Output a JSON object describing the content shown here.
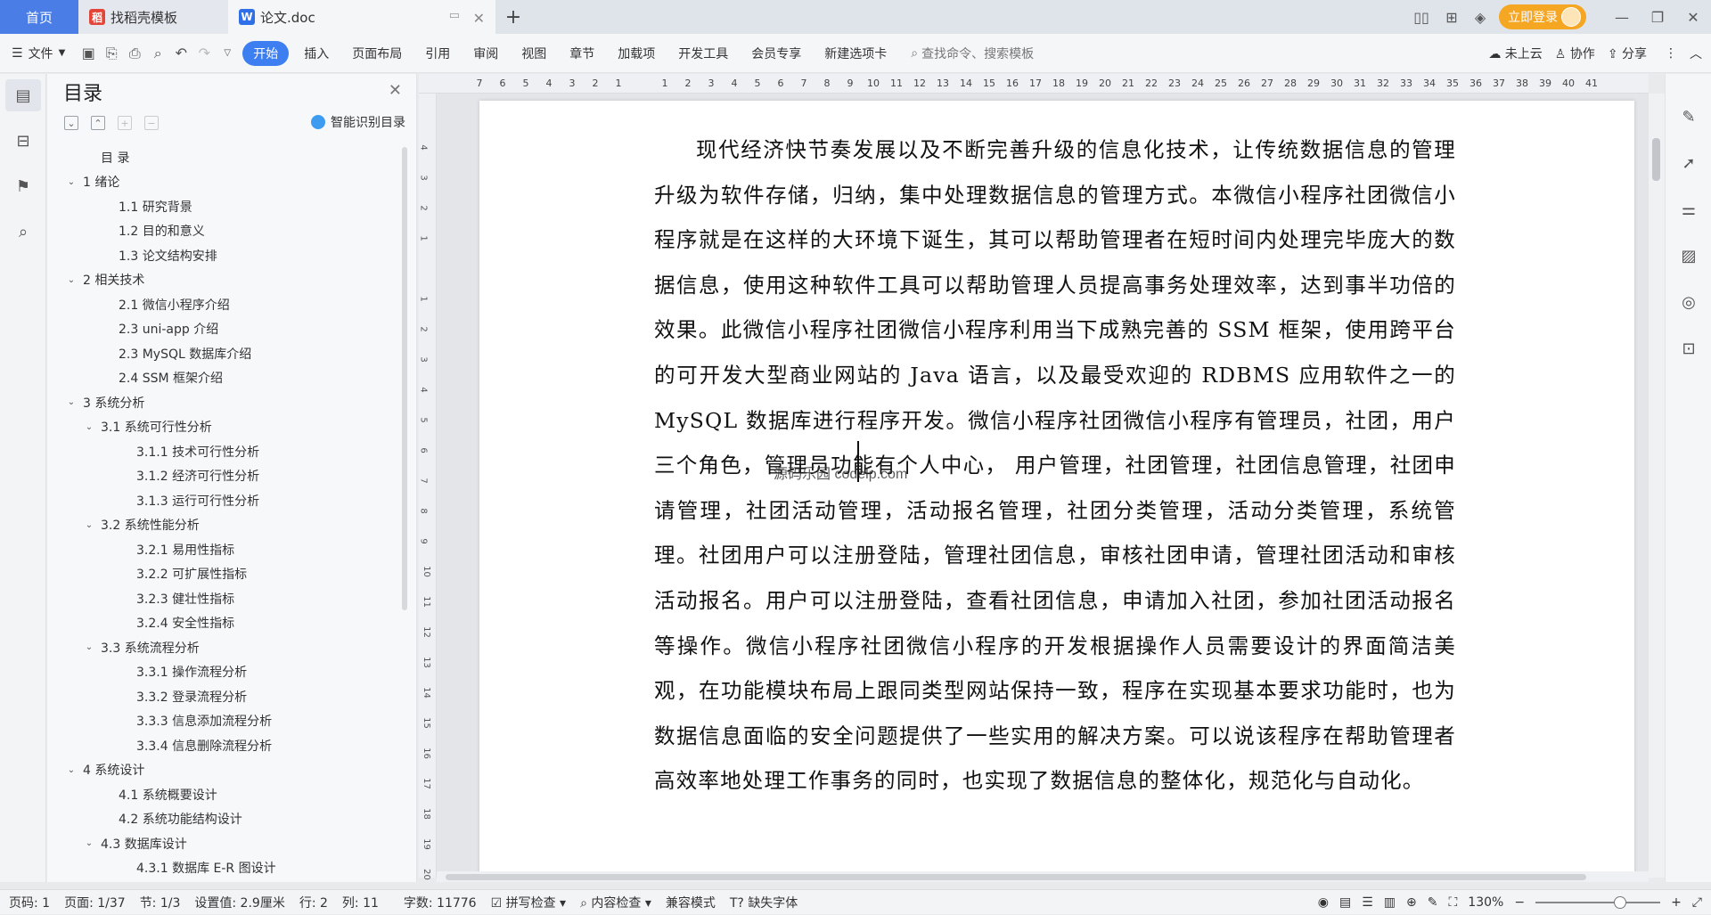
{
  "titlebar": {
    "home_tab": "首页",
    "tab1": "找稻壳模板",
    "tab2": "论文.doc",
    "login": "立即登录"
  },
  "toolbar": {
    "file": "文件",
    "tabs": [
      "开始",
      "插入",
      "页面布局",
      "引用",
      "审阅",
      "视图",
      "章节",
      "加载项",
      "开发工具",
      "会员专享",
      "新建选项卡"
    ],
    "search_placeholder": "查找命令、搜索模板",
    "cloud": "未上云",
    "collab": "协作",
    "share": "分享"
  },
  "toc": {
    "title": "目录",
    "smart": "智能识别目录",
    "items": [
      {
        "label": "目  录",
        "level": 1,
        "arrow": ""
      },
      {
        "label": "1 绪论",
        "level": 0,
        "arrow": "v"
      },
      {
        "label": "1.1  研究背景",
        "level": 2,
        "arrow": ""
      },
      {
        "label": "1.2  目的和意义",
        "level": 2,
        "arrow": ""
      },
      {
        "label": "1.3  论文结构安排",
        "level": 2,
        "arrow": ""
      },
      {
        "label": "2 相关技术",
        "level": 0,
        "arrow": "v"
      },
      {
        "label": "2.1  微信小程序介绍",
        "level": 2,
        "arrow": ""
      },
      {
        "label": "2.3 uni-app 介绍",
        "level": 2,
        "arrow": ""
      },
      {
        "label": "2.3 MySQL 数据库介绍",
        "level": 2,
        "arrow": ""
      },
      {
        "label": "2.4 SSM 框架介绍",
        "level": 2,
        "arrow": ""
      },
      {
        "label": "3 系统分析",
        "level": 0,
        "arrow": "v"
      },
      {
        "label": "3.1  系统可行性分析",
        "level": 1,
        "arrow": "v"
      },
      {
        "label": "3.1.1  技术可行性分析",
        "level": 3,
        "arrow": ""
      },
      {
        "label": "3.1.2  经济可行性分析",
        "level": 3,
        "arrow": ""
      },
      {
        "label": "3.1.3  运行可行性分析",
        "level": 3,
        "arrow": ""
      },
      {
        "label": "3.2  系统性能分析",
        "level": 1,
        "arrow": "v"
      },
      {
        "label": "3.2.1  易用性指标",
        "level": 3,
        "arrow": ""
      },
      {
        "label": "3.2.2  可扩展性指标",
        "level": 3,
        "arrow": ""
      },
      {
        "label": "3.2.3  健壮性指标",
        "level": 3,
        "arrow": ""
      },
      {
        "label": "3.2.4  安全性指标",
        "level": 3,
        "arrow": ""
      },
      {
        "label": "3.3  系统流程分析",
        "level": 1,
        "arrow": "v"
      },
      {
        "label": "3.3.1  操作流程分析",
        "level": 3,
        "arrow": ""
      },
      {
        "label": "3.3.2  登录流程分析",
        "level": 3,
        "arrow": ""
      },
      {
        "label": "3.3.3  信息添加流程分析",
        "level": 3,
        "arrow": ""
      },
      {
        "label": "3.3.4  信息删除流程分析",
        "level": 3,
        "arrow": ""
      },
      {
        "label": "4 系统设计",
        "level": 0,
        "arrow": "v"
      },
      {
        "label": "4.1  系统概要设计",
        "level": 2,
        "arrow": ""
      },
      {
        "label": "4.2  系统功能结构设计",
        "level": 2,
        "arrow": ""
      },
      {
        "label": "4.3  数据库设计",
        "level": 1,
        "arrow": "v"
      },
      {
        "label": "4.3.1  数据库 E-R 图设计",
        "level": 3,
        "arrow": ""
      }
    ]
  },
  "ruler": {
    "h": [
      "7",
      "6",
      "5",
      "4",
      "3",
      "2",
      "1",
      "",
      "1",
      "2",
      "3",
      "4",
      "5",
      "6",
      "7",
      "8",
      "9",
      "10",
      "11",
      "12",
      "13",
      "14",
      "15",
      "16",
      "17",
      "18",
      "19",
      "20",
      "21",
      "22",
      "23",
      "24",
      "25",
      "26",
      "27",
      "28",
      "29",
      "30",
      "31",
      "32",
      "33",
      "34",
      "35",
      "36",
      "37",
      "38",
      "39",
      "40",
      "41"
    ],
    "v": [
      "4",
      "3",
      "2",
      "1",
      "",
      "1",
      "2",
      "3",
      "4",
      "5",
      "6",
      "7",
      "8",
      "9",
      "10",
      "11",
      "12",
      "13",
      "14",
      "15",
      "16",
      "17",
      "18",
      "19",
      "20"
    ]
  },
  "document": {
    "paragraph": "现代经济快节奏发展以及不断完善升级的信息化技术，让传统数据信息的管理升级为软件存储，归纳，集中处理数据信息的管理方式。本微信小程序社团微信小程序就是在这样的大环境下诞生，其可以帮助管理者在短时间内处理完毕庞大的数据信息，使用这种软件工具可以帮助管理人员提高事务处理效率，达到事半功倍的效果。此微信小程序社团微信小程序利用当下成熟完善的 SSM 框架，使用跨平台的可开发大型商业网站的 Java 语言，以及最受欢迎的 RDBMS 应用软件之一的 MySQL 数据库进行程序开发。微信小程序社团微信小程序有管理员，社团，用户三个角色，管理员功能有个人中心，  用户管理，社团管理，社团信息管理，社团申请管理，社团活动管理，活动报名管理，社团分类管理，活动分类管理，系统管理。社团用户可以注册登陆，管理社团信息，审核社团申请，管理社团活动和审核活动报名。用户可以注册登陆，查看社团信息，申请加入社团，参加社团活动报名等操作。微信小程序社团微信小程序的开发根据操作人员需要设计的界面简洁美观，在功能模块布局上跟同类型网站保持一致，程序在实现基本要求功能时，也为数据信息面临的安全问题提供了一些实用的解决方案。可以说该程序在帮助管理者高效率地处理工作事务的同时，也实现了数据信息的整体化，规范化与自动化。",
    "watermark": "源码乐园 codelp.com"
  },
  "status": {
    "page_no": "页码: 1",
    "pages": "页面: 1/37",
    "section": "节: 1/3",
    "setting": "设置值: 2.9厘米",
    "row": "行: 2",
    "col": "列: 11",
    "words": "字数: 11776",
    "spell": "拼写检查",
    "content": "内容检查",
    "compat": "兼容模式",
    "font_missing": "缺失字体",
    "zoom": "130%"
  }
}
